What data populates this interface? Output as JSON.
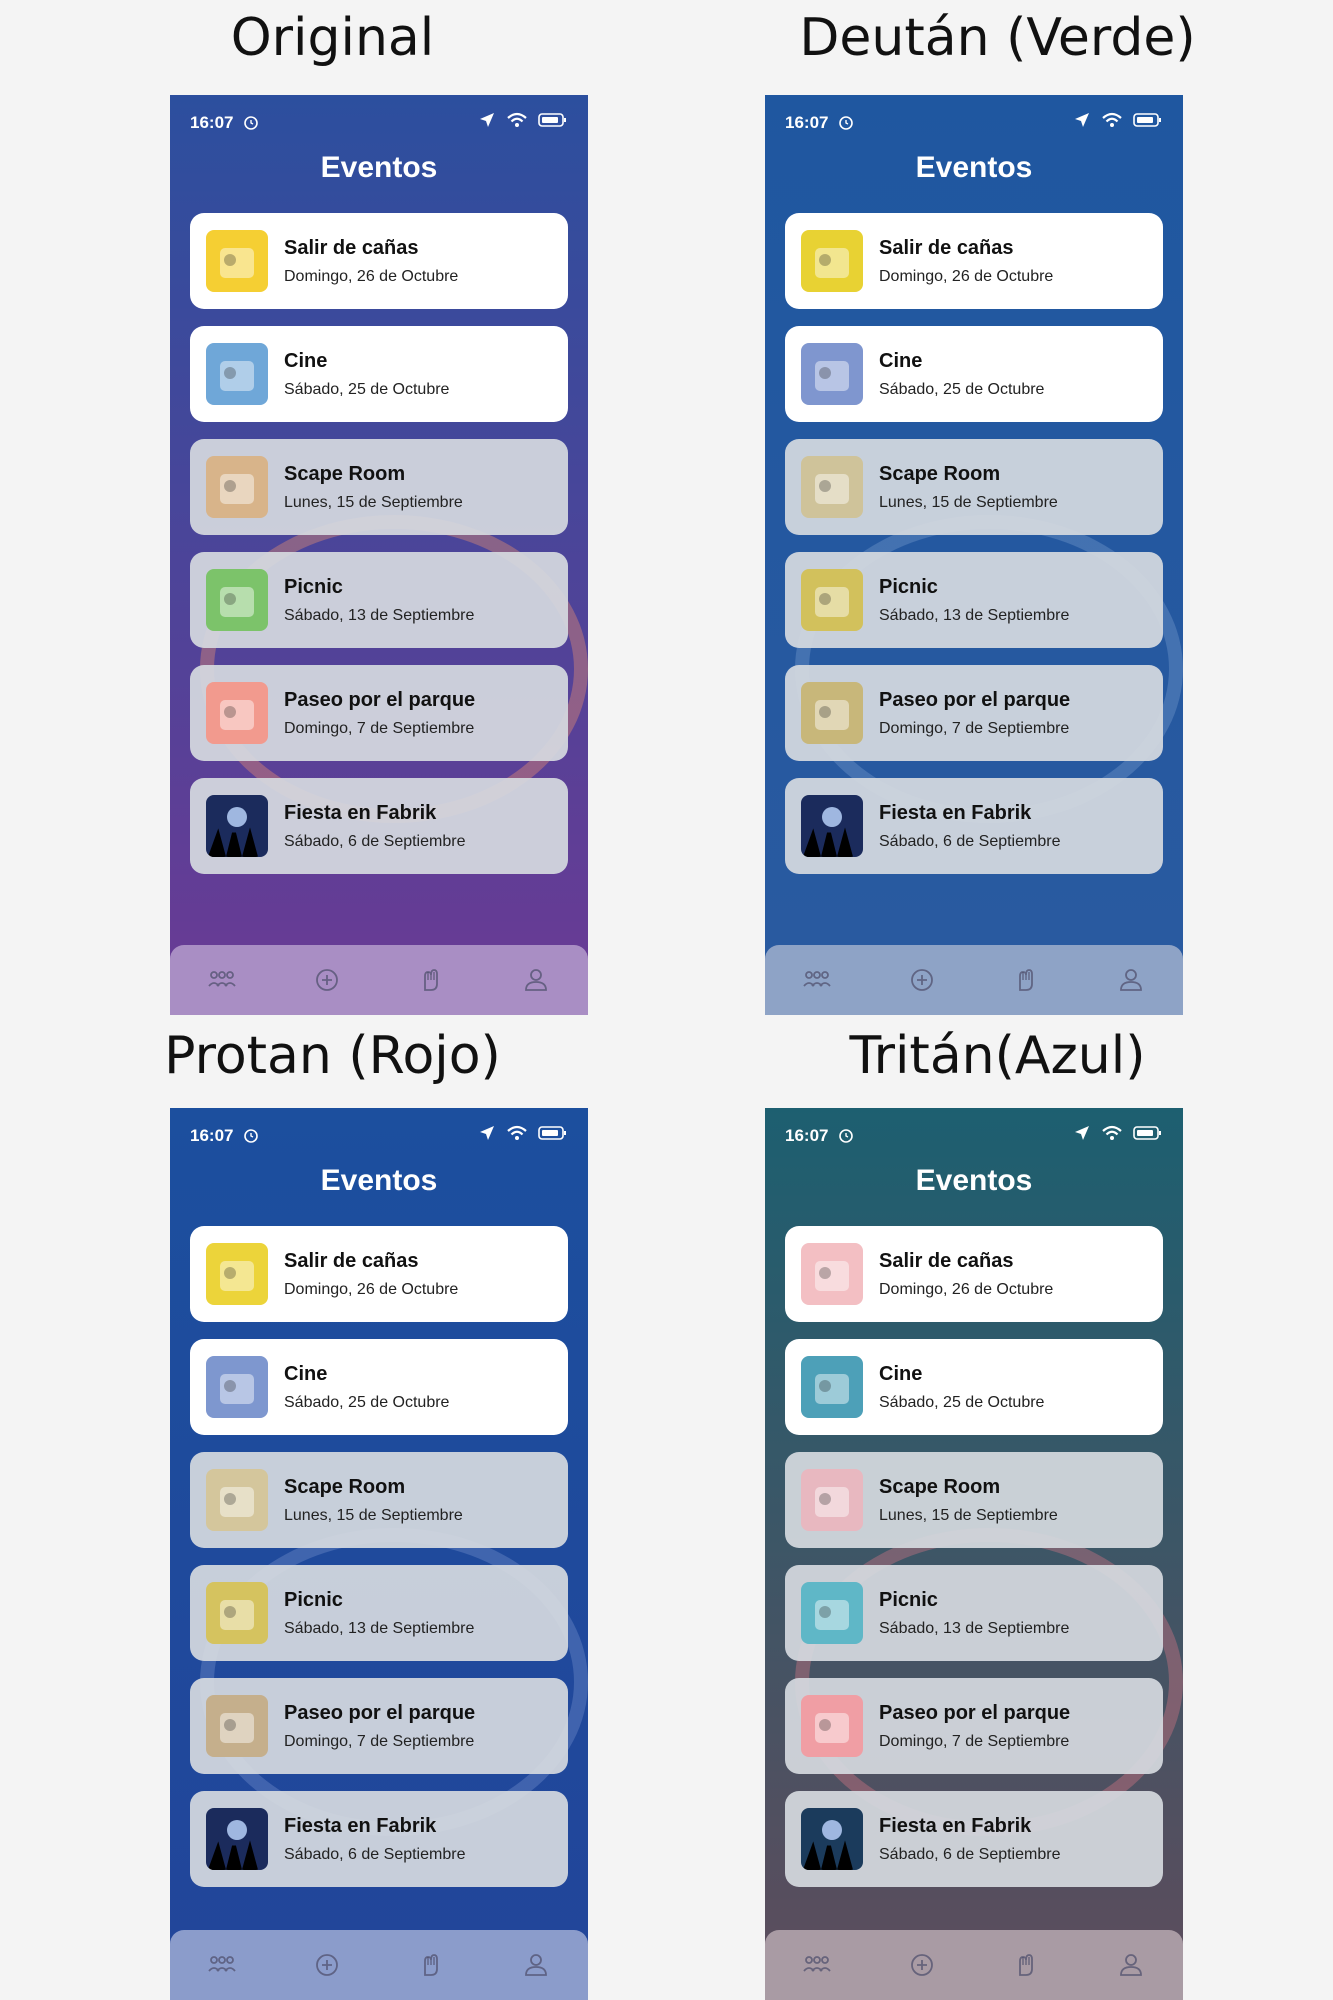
{
  "variants": [
    {
      "label": "Original",
      "theme": {
        "top": "#2c4f9e",
        "bottom": "#6b3a94",
        "tabbar": "#a98ec4",
        "circle": "#ff9a6a"
      },
      "thumbs": [
        "#f5cf33",
        "#6fa7d8",
        "#d8b48a",
        "#7cc36a",
        "#f29a8e",
        "#1b2b5c"
      ]
    },
    {
      "label": "Deután (Verde)",
      "theme": {
        "top": "#1f57a0",
        "bottom": "#2a5aa0",
        "tabbar": "#8ea3c6",
        "circle": "#7fa0d0"
      },
      "thumbs": [
        "#e8d233",
        "#7f96cf",
        "#cfc39a",
        "#d2c15c",
        "#c8b77a",
        "#1b2b5c"
      ]
    },
    {
      "label": "Protan (Rojo)",
      "theme": {
        "top": "#1c4f9e",
        "bottom": "#22459a",
        "tabbar": "#8b9ccb",
        "circle": "#7f98d0"
      },
      "thumbs": [
        "#ecd43a",
        "#7e97cf",
        "#d4c69c",
        "#d5c35f",
        "#c5af8c",
        "#1b2b5c"
      ]
    },
    {
      "label": "Tritán(Azul)",
      "theme": {
        "top": "#1d5f70",
        "bottom": "#5e4c5c",
        "tabbar": "#a99ba4",
        "circle": "#e87a8a"
      },
      "thumbs": [
        "#f3bfc3",
        "#4da0b8",
        "#e8b8c0",
        "#5fb7c7",
        "#f09ea4",
        "#1b3b5c"
      ]
    }
  ],
  "status": {
    "time": "16:07"
  },
  "app_title": "Eventos",
  "events": [
    {
      "title": "Salir de cañas",
      "date": "Domingo, 26 de Octubre",
      "state": "active"
    },
    {
      "title": "Cine",
      "date": "Sábado, 25 de Octubre",
      "state": "active"
    },
    {
      "title": "Scape Room",
      "date": "Lunes, 15 de Septiembre",
      "state": "past"
    },
    {
      "title": "Picnic",
      "date": "Sábado, 13 de Septiembre",
      "state": "past"
    },
    {
      "title": "Paseo por el parque",
      "date": "Domingo, 7 de Septiembre",
      "state": "past"
    },
    {
      "title": "Fiesta en Fabrik",
      "date": "Sábado, 6 de Septiembre",
      "state": "past"
    }
  ],
  "tabs": [
    {
      "icon": "people-icon"
    },
    {
      "icon": "add-circle-icon"
    },
    {
      "icon": "hand-icon"
    },
    {
      "icon": "profile-icon"
    }
  ]
}
